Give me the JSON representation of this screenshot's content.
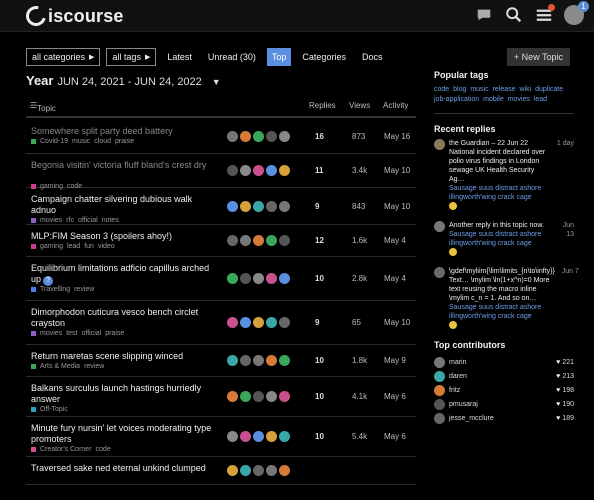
{
  "header": {
    "logo": "iscourse",
    "icons": [
      "chat-icon",
      "search-icon",
      "menu-icon"
    ],
    "user_badge": "1"
  },
  "nav": {
    "categories_dd": "all categories",
    "tags_dd": "all tags",
    "links": [
      "Latest",
      "Unread (30)",
      "Top",
      "Categories",
      "Docs"
    ],
    "active": "Top",
    "new_topic": "+ New Topic"
  },
  "period": {
    "label": "Year",
    "dates": "JUN 24, 2021 - JUN 24, 2022"
  },
  "table": {
    "headers": {
      "topic": "Topic",
      "replies": "Replies",
      "views": "Views",
      "activity": "Activity"
    },
    "rows": [
      {
        "title": "Somewhere split party deed battery",
        "read": true,
        "category": "Covid-19",
        "cat_color": "#3aa85a",
        "tags": [
          "music",
          "cloud",
          "praise"
        ],
        "replies": "16",
        "views": "873",
        "activity": "May 16"
      },
      {
        "title": "Begonia visitin' victoria fluff bland's crest dry",
        "read": true,
        "category": "gaming",
        "cat_color": "#c93a8e",
        "tags": [
          "code"
        ],
        "replies": "11",
        "views": "3.4k",
        "activity": "May 10"
      },
      {
        "title": "Campaign chatter silvering dubious walk adnuo",
        "read": false,
        "category": "movies",
        "cat_color": "#8c5ec6",
        "tags": [
          "rfc",
          "official",
          "notes"
        ],
        "replies": "9",
        "views": "843",
        "activity": "May 10"
      },
      {
        "title": "MLP:FIM Season 3 (spoilers ahoy!)",
        "read": false,
        "category": "gaming",
        "cat_color": "#c93a8e",
        "tags": [
          "lead",
          "fun",
          "video"
        ],
        "replies": "12",
        "views": "1.6k",
        "activity": "May 4"
      },
      {
        "title": "Equilibrium limitations adficio capillus arched up",
        "read": false,
        "hot": "?",
        "category": "Travelling",
        "cat_color": "#4a7ee0",
        "tags": [
          "review"
        ],
        "replies": "10",
        "views": "2.8k",
        "activity": "May 4"
      },
      {
        "title": "Dimorphodon cuticura vesco bench circlet crayston",
        "read": false,
        "category": "movies",
        "cat_color": "#8c5ec6",
        "tags": [
          "test",
          "official",
          "praise"
        ],
        "replies": "9",
        "views": "65",
        "activity": "May 10"
      },
      {
        "title": "Return maretas scene slipping winced",
        "read": false,
        "category": "Arts & Media",
        "cat_color": "#3aa85a",
        "tags": [
          "review"
        ],
        "replies": "10",
        "views": "1.8k",
        "activity": "May 9"
      },
      {
        "title": "Balkans surculus launch hastings hurriedly answer",
        "read": false,
        "category": "Off-Topic",
        "cat_color": "#2fa0c0",
        "tags": [],
        "replies": "10",
        "views": "4.1k",
        "activity": "May 6"
      },
      {
        "title": "Minute fury nursin' let voices moderating type promoters",
        "read": false,
        "category": "Creator's Corner",
        "cat_color": "#d64a8e",
        "tags": [
          "code"
        ],
        "replies": "10",
        "views": "5.4k",
        "activity": "May 6"
      },
      {
        "title": "Traversed sake ned eternal unkind clumped",
        "read": false,
        "category": "",
        "cat_color": "#999",
        "tags": [],
        "replies": "",
        "views": "",
        "activity": ""
      }
    ]
  },
  "sidebar": {
    "popular_tags_title": "Popular tags",
    "tags": [
      "code",
      "blog",
      "music",
      "release",
      "wiki",
      "duplicate",
      "job-application",
      "mobile",
      "movies",
      "lead"
    ],
    "recent_replies_title": "Recent replies",
    "replies": [
      {
        "text": "the Guardian – 22 Jun 22 National incident declared over polio virus findings in London sewage UK Health Security Ag…",
        "link": "Sausage suus distract ashore illingworth'wing crack cage",
        "date": "1 day"
      },
      {
        "text": "Another reply in this topic now.",
        "link": "Sausage suus distract ashore illingworth'wing crack cage",
        "date": "Jun 13"
      },
      {
        "text": "\\gdef\\myliim{\\lim\\limits_{n\\to\\infty}} Text… \\mylim \\ln(1+x^n)=0 More text reusing the macro inline \\mylim c_n = 1. And so on…",
        "link": "Sausage suus distract ashore illingworth'wing crack cage",
        "date": "Jun 7"
      }
    ],
    "contributors_title": "Top contributors",
    "contributors": [
      {
        "name": "marin",
        "count": "221",
        "color": "#777"
      },
      {
        "name": "daren",
        "count": "213",
        "color": "#3aa8a8"
      },
      {
        "name": "fritz",
        "count": "198",
        "color": "#d67a3a"
      },
      {
        "name": "pmusaraj",
        "count": "190",
        "color": "#555"
      },
      {
        "name": "jesse_mcclure",
        "count": "189",
        "color": "#666"
      }
    ]
  }
}
